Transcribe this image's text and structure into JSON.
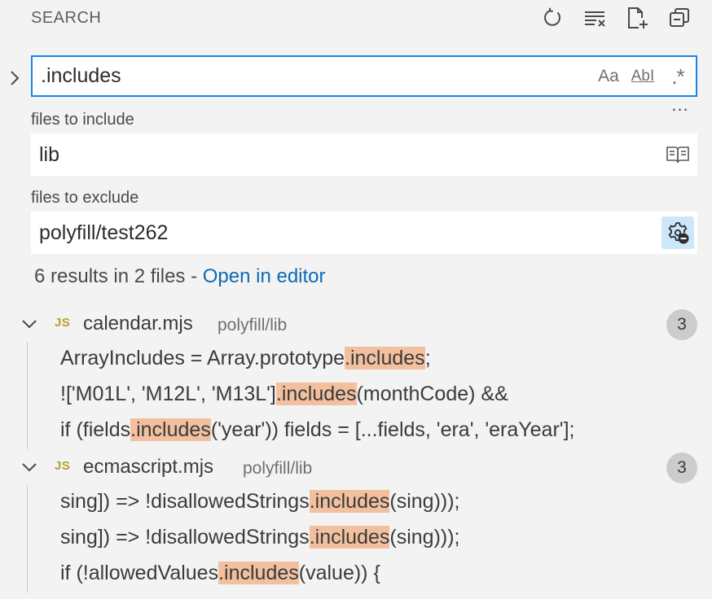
{
  "header": {
    "title": "SEARCH"
  },
  "search": {
    "value": ".includes",
    "options": {
      "match_case": "Aa",
      "whole_word": "AbI",
      "regex": ".*"
    },
    "more": "..."
  },
  "include": {
    "label": "files to include",
    "value": "lib"
  },
  "exclude": {
    "label": "files to exclude",
    "value": "polyfill/test262"
  },
  "summary": {
    "text": "6 results in 2 files - ",
    "link": "Open in editor"
  },
  "results": [
    {
      "badge": "JS",
      "name": "calendar.mjs",
      "path": "polyfill/lib",
      "count": "3",
      "matches": [
        {
          "before": "ArrayIncludes = Array.prototype",
          "match": ".includes",
          "after": ";"
        },
        {
          "before": "!['M01L', 'M12L', 'M13L']",
          "match": ".includes",
          "after": "(monthCode) &&"
        },
        {
          "before": "if (fields",
          "match": ".includes",
          "after": "('year')) fields = [...fields, 'era', 'eraYear'];"
        }
      ]
    },
    {
      "badge": "JS",
      "name": "ecmascript.mjs",
      "path": "polyfill/lib",
      "count": "3",
      "matches": [
        {
          "before": "sing]) => !disallowedStrings",
          "match": ".includes",
          "after": "(sing)));"
        },
        {
          "before": "sing]) => !disallowedStrings",
          "match": ".includes",
          "after": "(sing)));"
        },
        {
          "before": "if (!allowedValues",
          "match": ".includes",
          "after": "(value)) {"
        }
      ]
    }
  ],
  "icons": {
    "refresh": "refresh-icon",
    "clear": "clear-results-icon",
    "new_file": "new-search-editor-icon",
    "collapse": "collapse-all-icon",
    "toggle_replace": "chevron-right-icon",
    "reader": "book-icon",
    "exclude_settings": "gear-exclude-icon",
    "expand": "chevron-down-icon"
  },
  "colors": {
    "accent": "#1a85e5",
    "link": "#0f68b8",
    "highlight": "#f2c09f",
    "js_badge": "#b3a42a"
  }
}
